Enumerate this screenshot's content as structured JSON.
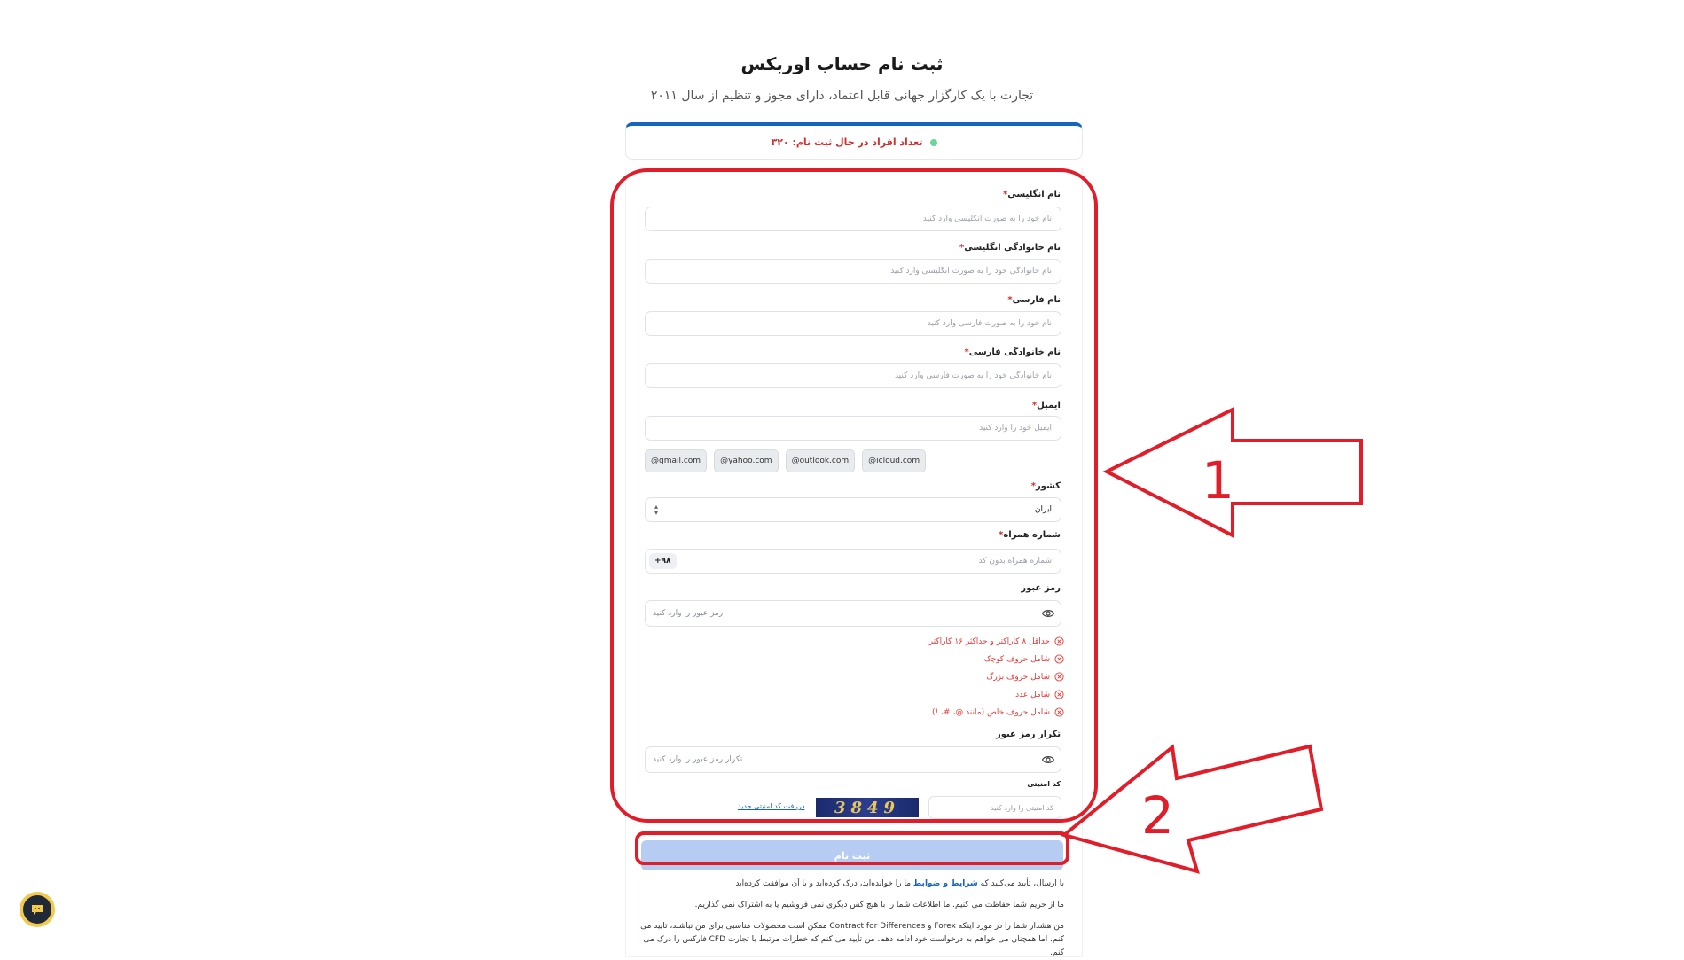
{
  "header": {
    "title": "ثبت نام حساب اوربکس",
    "subtitle": "تجارت با یک کارگزار جهانی قابل اعتماد، دارای مجوز و تنظیم از سال ۲۰۱۱"
  },
  "counter": {
    "text": "تعداد افراد در حال ثبت نام: ۳۲۰",
    "dot_color": "#6dd49a"
  },
  "form": {
    "required_mark": "*",
    "first_name_en": {
      "label": "نام انگلیسی",
      "placeholder": "نام خود را به صورت انگلیسی وارد کنید"
    },
    "last_name_en": {
      "label": "نام خانوادگی انگلیسی",
      "placeholder": "نام خانوادگی خود را به صورت انگلیسی وارد کنید"
    },
    "first_name_fa": {
      "label": "نام فارسی",
      "placeholder": "نام خود را به صورت فارسی وارد کنید"
    },
    "last_name_fa": {
      "label": "نام خانوادگی فارسی",
      "placeholder": "نام خانوادگی خود را به صورت فارسی وارد کنید"
    },
    "email": {
      "label": "ایمیل",
      "placeholder": "ایمیل خود را وارد کنید",
      "suggestions": [
        "@gmail.com",
        "@yahoo.com",
        "@outlook.com",
        "@icloud.com"
      ]
    },
    "country": {
      "label": "کشور",
      "value": "ایران"
    },
    "phone": {
      "label": "شماره همراه",
      "prefix": "+۹۸",
      "placeholder": "شماره همراه بدون کد"
    },
    "password": {
      "label": "رمز عبور",
      "placeholder": "رمز عبور را وارد کنید",
      "rules": [
        "حداقل ۸ کاراکتر و حداکثر ۱۶ کاراکتر",
        "شامل حروف کوچک",
        "شامل حروف بزرگ",
        "شامل عدد",
        "شامل حروف خاص (مانند @، #، !)"
      ]
    },
    "password_confirm": {
      "label": "تکرار رمز عبور",
      "placeholder": "تکرار رمز عبور را وارد کنید"
    },
    "captcha": {
      "label": "کد امنیتی",
      "placeholder": "کد امنیتی را وارد کنید",
      "image_text": "3849",
      "refresh_label": "دریافت کد امنیتی جدید"
    },
    "submit_label": "ثبت نام"
  },
  "notes": {
    "terms_prefix": "با ارسال، تأیید می‌کنید که",
    "terms_link": "شرایط و ضوابط",
    "terms_suffix": "ما را خوانده‌اید، درک کرده‌اید و با آن موافقت کرده‌اید",
    "privacy": "ما از حریم شما حفاظت می کنیم. ما اطلاعات شما را با هیچ کس دیگری نمی فروشیم یا به اشتراک نمی گذاریم.",
    "warning": "من هشدار شما را در مورد اینکه Forex و Contract for Differences ممکن است محصولات مناسبی برای من نباشند، تایید می کنم. اما همچنان می خواهم به درخواست خود ادامه دهم. من تأیید می کنم که خطرات مرتبط با تجارت CFD فارکس را درک می کنم."
  },
  "annotations": {
    "arrow_1_label": "1",
    "arrow_2_label": "2",
    "color": "#e11d2a"
  },
  "chat": {
    "icon": "chat-bubble-icon"
  }
}
